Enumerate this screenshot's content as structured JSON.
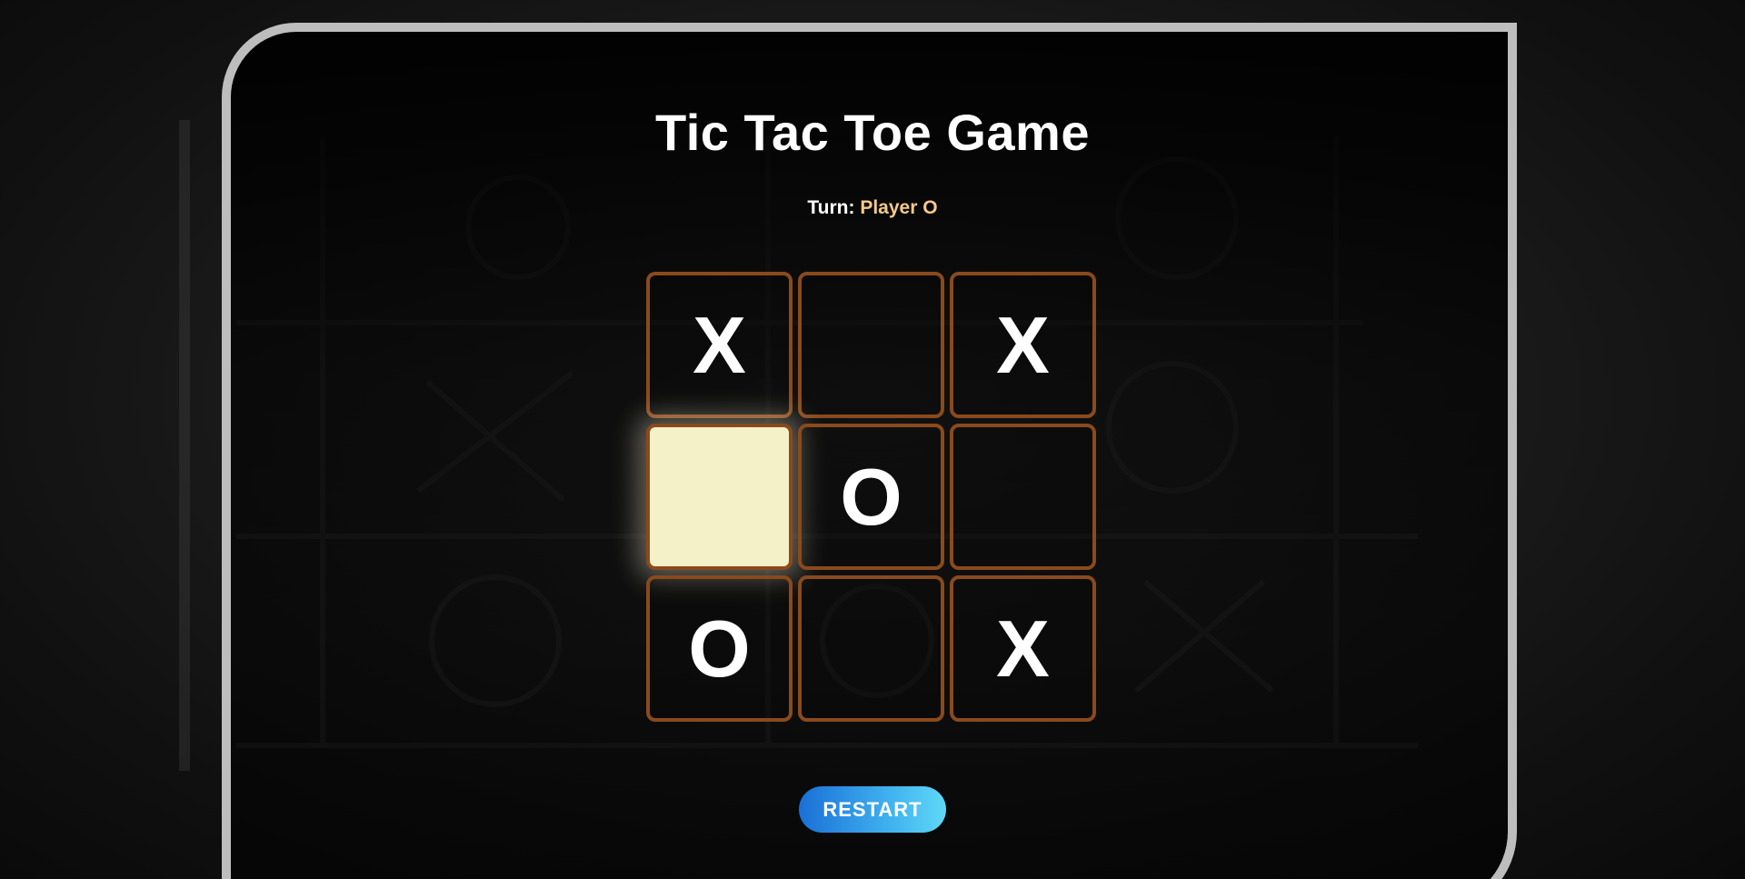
{
  "game": {
    "title": "Tic Tac Toe Game",
    "turn_label": "Turn:",
    "current_player": "Player O",
    "board": [
      "X",
      "",
      "X",
      "",
      "O",
      "",
      "O",
      "",
      "X"
    ],
    "highlighted_cell_index": 3,
    "restart_label": "RESTART"
  },
  "colors": {
    "cell_border": "#8a4a1c",
    "highlight_cell": "#f4f1c8",
    "player_accent": "#f6c98b",
    "button_gradient_start": "#1a6fd6",
    "button_gradient_end": "#5fd8f6"
  }
}
